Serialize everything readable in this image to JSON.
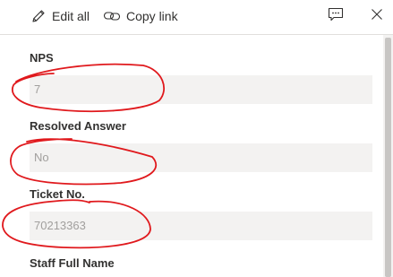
{
  "toolbar": {
    "edit_all_label": "Edit all",
    "copy_link_label": "Copy link",
    "icons": [
      "pencil-icon",
      "link-icon",
      "comment-icon",
      "close-icon"
    ]
  },
  "fields": [
    {
      "label": "NPS",
      "value": "7"
    },
    {
      "label": "Resolved Answer",
      "value": "No"
    },
    {
      "label": "Ticket No.",
      "value": "70213363"
    },
    {
      "label": "Staff Full Name"
    }
  ],
  "colors": {
    "annotation": "#e0191d",
    "field_background": "#f3f2f1",
    "field_value_text": "#a19f9d"
  }
}
